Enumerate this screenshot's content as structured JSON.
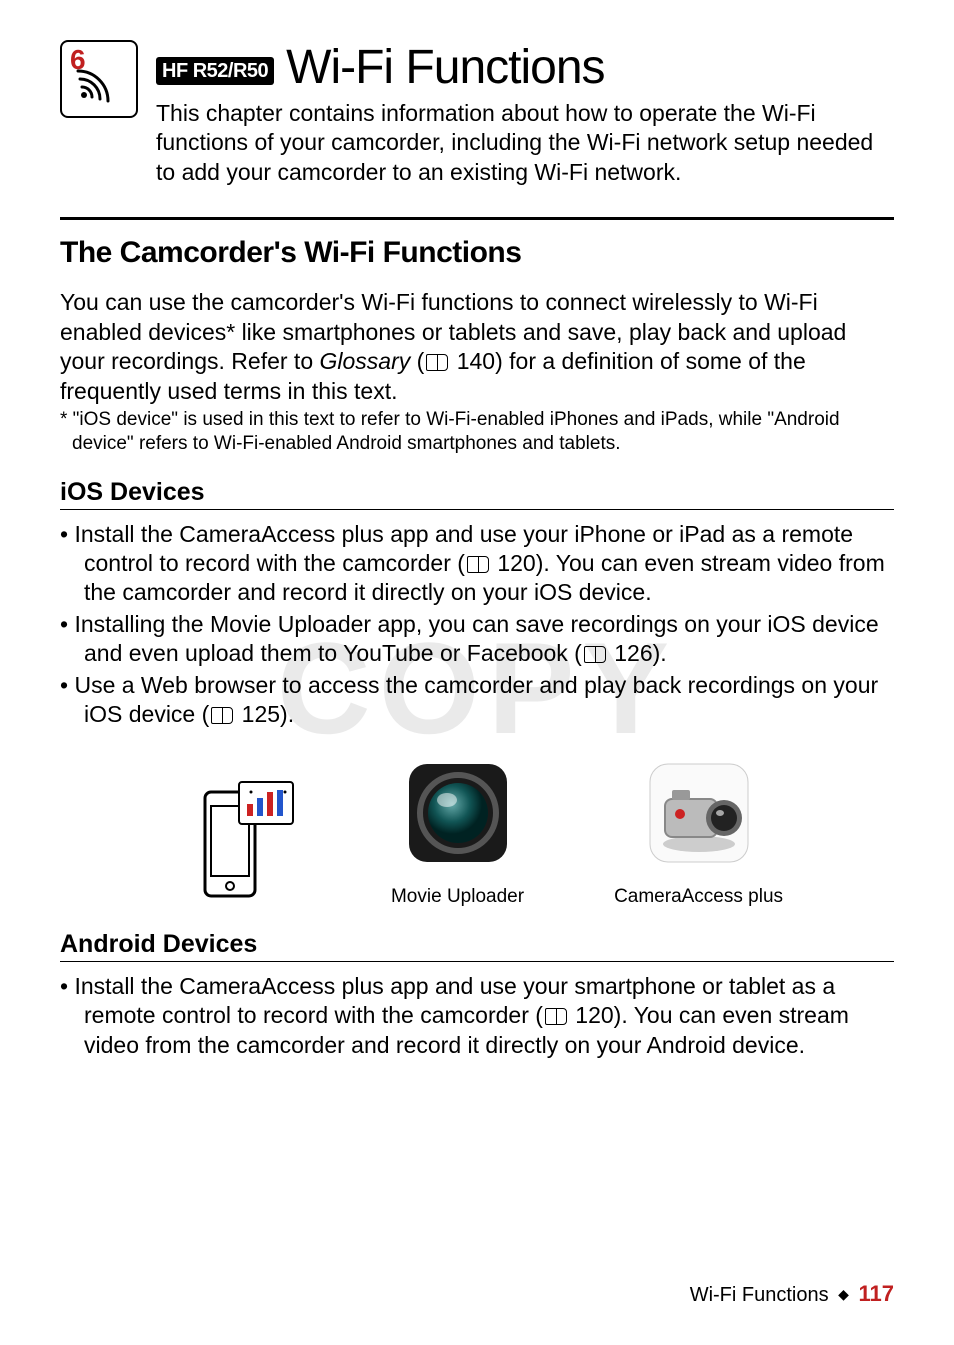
{
  "chapter": {
    "number": "6"
  },
  "header": {
    "model_badge": "HF R52/R50",
    "title": "Wi-Fi Functions",
    "intro": "This chapter contains information about how to operate the Wi-Fi functions of your camcorder, including the Wi-Fi network setup needed to add your camcorder to an existing Wi-Fi network."
  },
  "section": {
    "title": "The Camcorder's Wi-Fi Functions",
    "para_pre": "You can use the camcorder's Wi-Fi functions to connect wirelessly to Wi-Fi enabled devices* like smartphones or tablets and save, play back and upload your recordings. Refer to ",
    "para_italic": "Glossary",
    "para_mid": " (",
    "para_ref_page": "140",
    "para_post": ") for a definition of some of the frequently used terms in this text.",
    "footnote": "* \"iOS device\" is used in this text to refer to Wi-Fi-enabled iPhones and iPads, while \"Android device\" refers to Wi-Fi-enabled Android smartphones and tablets."
  },
  "ios": {
    "title": "iOS Devices",
    "b1_pre": "Install the CameraAccess plus app and use your iPhone or iPad as a remote control to record with the camcorder (",
    "b1_ref": "120",
    "b1_post": "). You can even stream video from the camcorder and record it directly on your iOS device.",
    "b2_pre": "Installing the Movie Uploader app, you can save recordings on your iOS device and even upload them to YouTube or Facebook (",
    "b2_ref": "126",
    "b2_post": ").",
    "b3_pre": "Use a Web browser to access the camcorder and play back recordings on your iOS device (",
    "b3_ref": "125",
    "b3_post": ")."
  },
  "figures": {
    "cap1": "Movie Uploader",
    "cap2": "CameraAccess plus"
  },
  "android": {
    "title": "Android Devices",
    "b1_pre": "Install the CameraAccess plus app and use your smartphone or tablet as a remote control to record with the camcorder (",
    "b1_ref": "120",
    "b1_post": "). You can even stream video from the camcorder and record it directly on your Android device."
  },
  "watermark": "COPY",
  "footer": {
    "label": "Wi-Fi Functions",
    "page": "117"
  }
}
